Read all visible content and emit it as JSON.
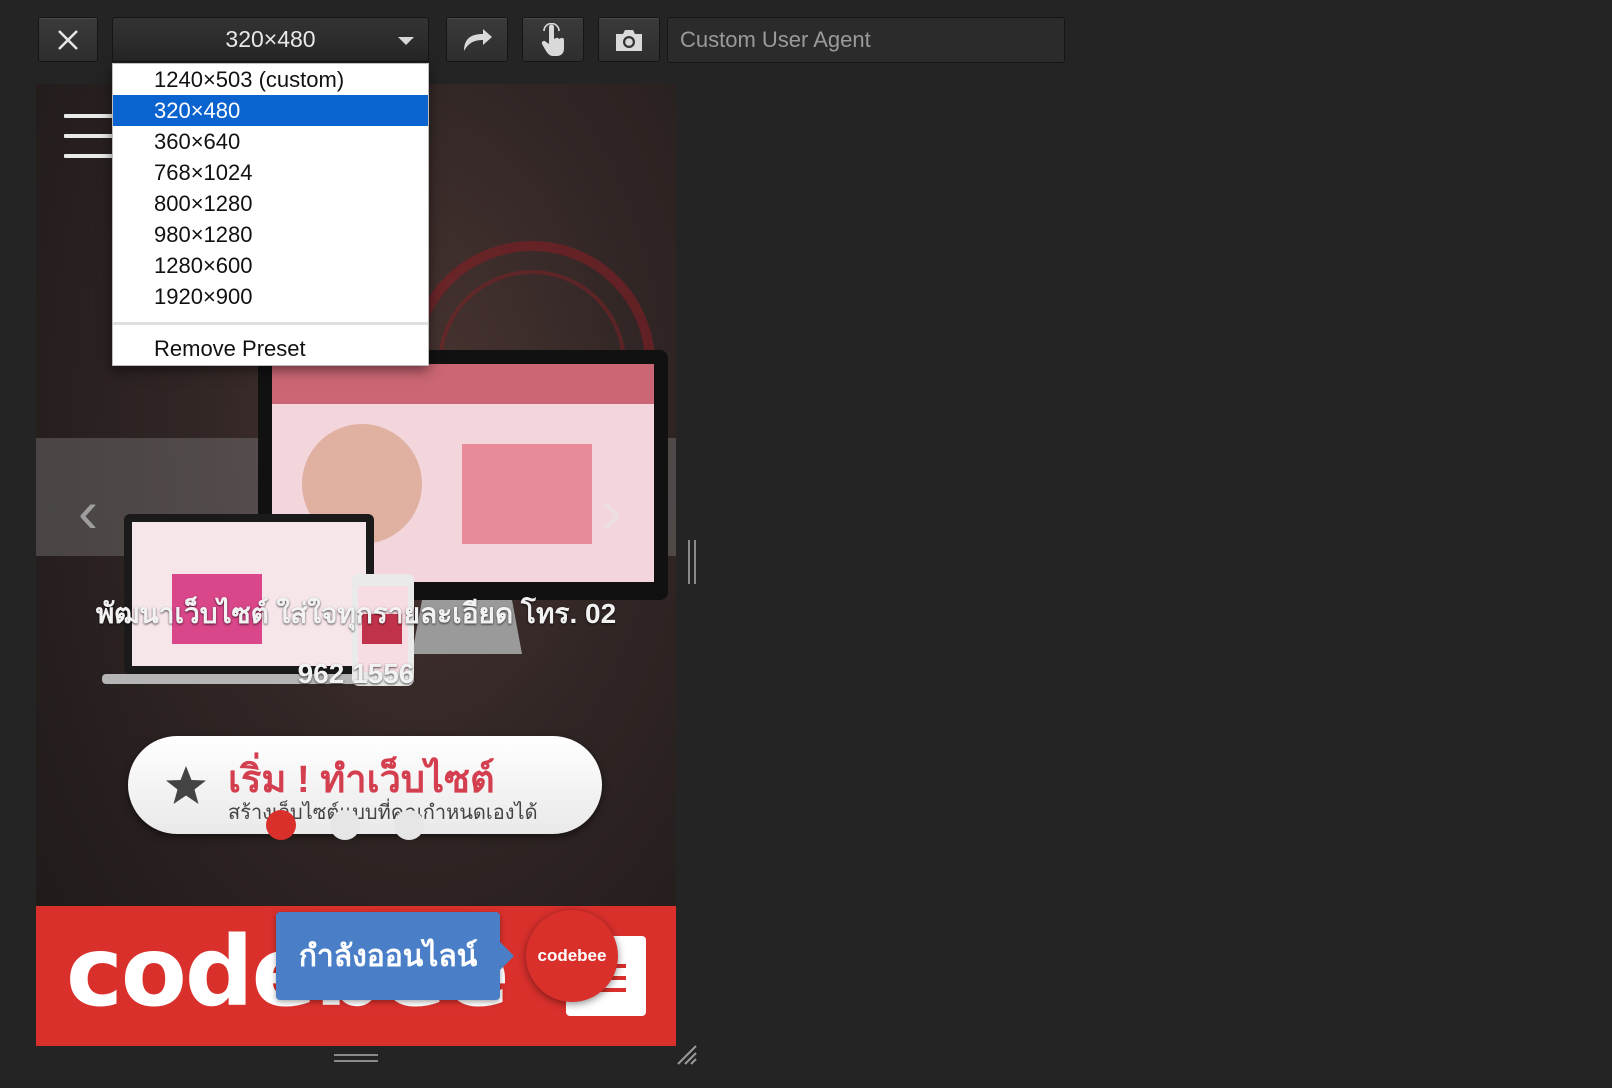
{
  "toolbar": {
    "close_icon": "close-icon",
    "selected_size": "320×480",
    "rotate_icon": "rotate-icon",
    "touch_icon": "touch-icon",
    "screenshot_icon": "camera-icon",
    "user_agent_placeholder": "Custom User Agent"
  },
  "size_dropdown": {
    "options": [
      "1240×503 (custom)",
      "320×480",
      "360×640",
      "768×1024",
      "800×1280",
      "980×1280",
      "1280×600",
      "1920×900"
    ],
    "selected_index": 1,
    "remove_label": "Remove Preset"
  },
  "viewport": {
    "tagline_line1": "พัฒนาเว็บไซต์ ใส่ใจทุกรายละเอียด โทร. 02",
    "tagline_line2": "962 1556",
    "cta_title": "เริ่ม ! ทำเว็บไซต์",
    "cta_subtitle": "สร้างเว็บไซต์แบบที่คุณกำหนดเองได้",
    "slider_dots": 3,
    "active_dot": 0,
    "footer_logo": "codebee",
    "online_label": "กำลังออนไลน์",
    "online_avatar_text": "codebee",
    "colors": {
      "brand_red": "#d9302c",
      "cta_red": "#d43f4f",
      "online_blue": "#4a7fc8",
      "selection_blue": "#0b63d0"
    }
  }
}
